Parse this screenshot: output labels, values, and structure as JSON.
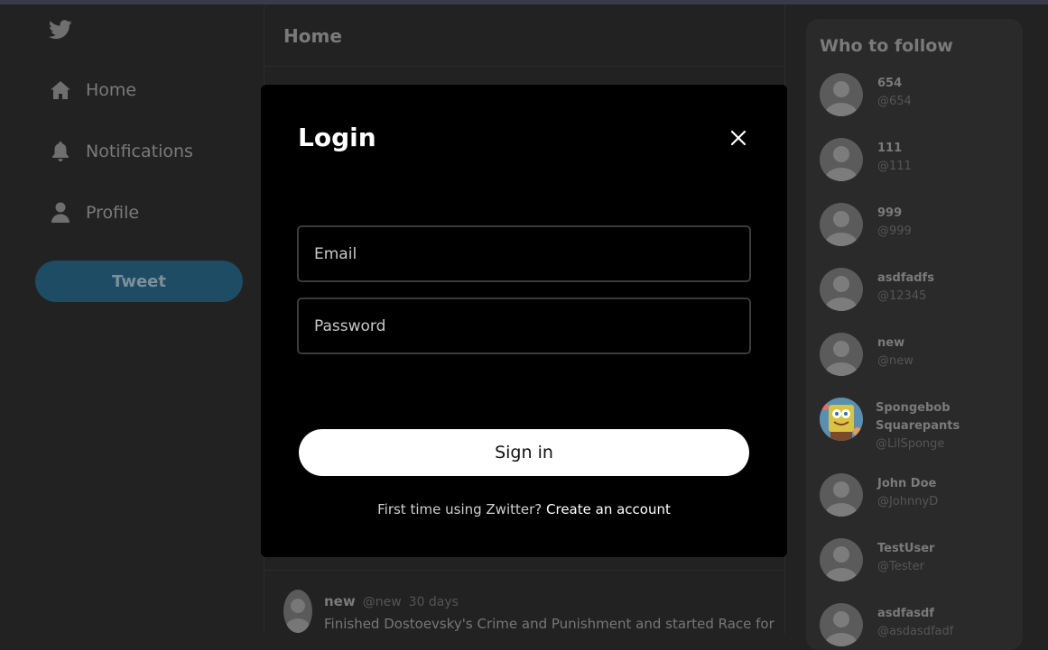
{
  "nav": {
    "logo_icon": "twitter-bird-icon",
    "items": [
      {
        "label": "Home",
        "icon": "home-icon"
      },
      {
        "label": "Notifications",
        "icon": "bell-icon"
      },
      {
        "label": "Profile",
        "icon": "user-icon"
      }
    ],
    "tweet_button": "Tweet"
  },
  "main": {
    "title": "Home",
    "tweet": {
      "name": "new",
      "handle": "@new",
      "time": "30 days",
      "text": "Finished Dostoevsky's Crime and Punishment and started Race for"
    }
  },
  "who_to_follow": {
    "title": "Who to follow",
    "users": [
      {
        "name": "654",
        "handle": "@654"
      },
      {
        "name": "111",
        "handle": "@111"
      },
      {
        "name": "999",
        "handle": "@999"
      },
      {
        "name": "asdfadfs",
        "handle": "@12345"
      },
      {
        "name": "new",
        "handle": "@new"
      },
      {
        "name": "Spongebob Squarepants",
        "handle": "@LilSponge"
      },
      {
        "name": "John Doe",
        "handle": "@JohnnyD"
      },
      {
        "name": "TestUser",
        "handle": "@Tester"
      },
      {
        "name": "asdfasdf",
        "handle": "@asdasdfadf"
      }
    ]
  },
  "modal": {
    "title": "Login",
    "close_icon": "close-icon",
    "email_placeholder": "Email",
    "password_placeholder": "Password",
    "signin_label": "Sign in",
    "signup_prompt": "First time using Zwitter?",
    "signup_link": "Create an account"
  },
  "colors": {
    "background": "#222222",
    "modal": "#000000",
    "accent": "#1e4c65"
  }
}
